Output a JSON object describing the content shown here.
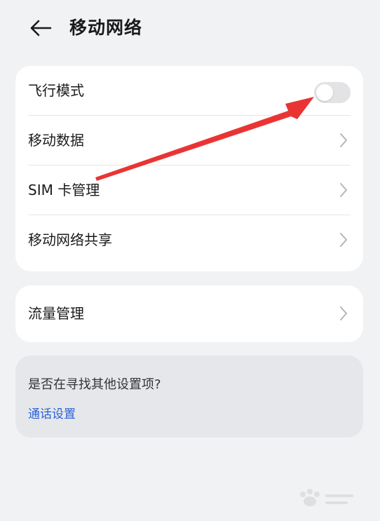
{
  "header": {
    "title": "移动网络"
  },
  "main_card": {
    "items": [
      {
        "label": "飞行模式",
        "type": "toggle",
        "toggle_state": "off"
      },
      {
        "label": "移动数据",
        "type": "chevron"
      },
      {
        "label": "SIM 卡管理",
        "type": "chevron"
      },
      {
        "label": "移动网络共享",
        "type": "chevron"
      }
    ]
  },
  "traffic_card": {
    "label": "流量管理"
  },
  "suggestion": {
    "question": "是否在寻找其他设置项?",
    "link": "通话设置"
  },
  "colors": {
    "background": "#f1f2f4",
    "card": "#ffffff",
    "link": "#2962d9",
    "arrow": "#ea3434"
  },
  "icons": [
    "back-arrow-icon",
    "chevron-right-icon",
    "annotation-arrow-icon"
  ]
}
